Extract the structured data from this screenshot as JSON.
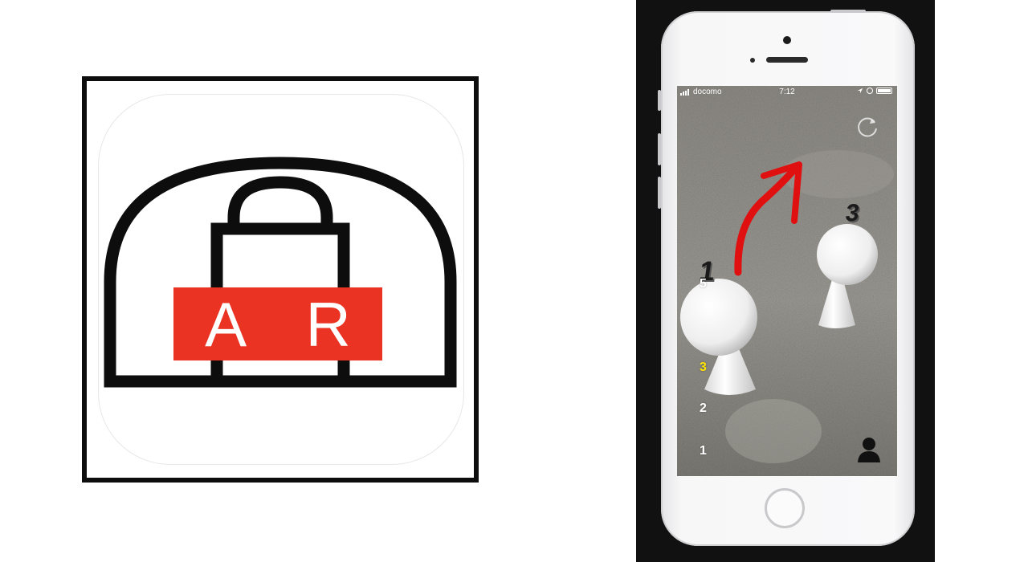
{
  "app_icon": {
    "badge_text": "A R",
    "colors": {
      "frame": "#0d0d0d",
      "line": "#0d0d0d",
      "badge": "#ea3323",
      "badge_text": "#ffffff"
    }
  },
  "phone": {
    "status_bar": {
      "carrier": "docomo",
      "time": "7:12"
    },
    "icons": {
      "reload": "reload-icon",
      "profile": "profile-icon",
      "arrow": "red-arrow"
    },
    "floor_selector": {
      "labels": [
        "5",
        "3",
        "2",
        "1"
      ],
      "selected": "3",
      "selected_color": "#ffe600"
    },
    "ar_markers": [
      {
        "label": "1",
        "type": "white-cone-marker"
      },
      {
        "label": "3",
        "type": "white-cone-marker"
      }
    ]
  }
}
